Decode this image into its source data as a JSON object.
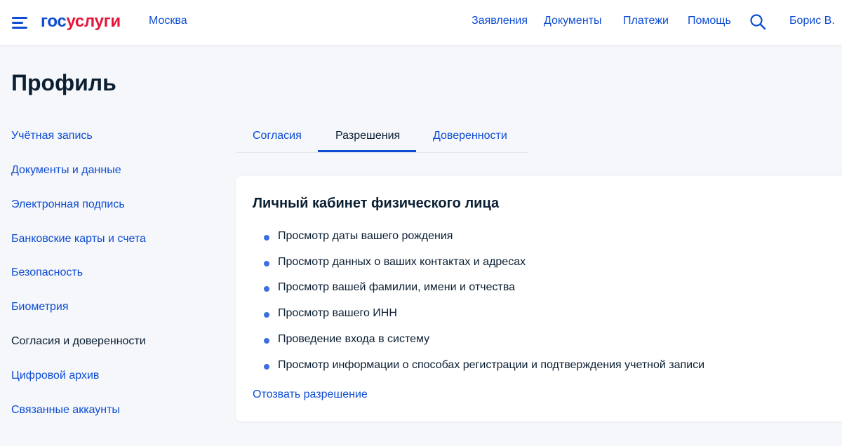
{
  "header": {
    "logo_part1": "гос",
    "logo_part2": "услуги",
    "city": "Москва",
    "nav": [
      "Заявления",
      "Документы",
      "Платежи",
      "Помощь"
    ],
    "user": "Борис В.",
    "icons": {
      "menu": "burger-menu-icon",
      "search": "search-icon"
    }
  },
  "page": {
    "title": "Профиль"
  },
  "sidebar": {
    "items": [
      {
        "label": "Учётная запись",
        "active": false
      },
      {
        "label": "Документы и данные",
        "active": false
      },
      {
        "label": "Электронная подпись",
        "active": false
      },
      {
        "label": "Банковские карты и счета",
        "active": false
      },
      {
        "label": "Безопасность",
        "active": false
      },
      {
        "label": "Биометрия",
        "active": false
      },
      {
        "label": "Согласия и доверенности",
        "active": true
      },
      {
        "label": "Цифровой архив",
        "active": false
      },
      {
        "label": "Связанные аккаунты",
        "active": false
      }
    ]
  },
  "tabs": {
    "items": [
      "Согласия",
      "Разрешения",
      "Доверенности"
    ],
    "active": "Разрешения"
  },
  "card": {
    "title": "Личный кабинет физического лица",
    "permissions": [
      "Просмотр даты вашего рождения",
      "Просмотр данных о ваших контактах и адресах",
      "Просмотр вашей фамилии, имени и отчества",
      "Просмотр вашего ИНН",
      "Проведение входа в систему",
      "Просмотр информации о способах регистрации и подтверждения учетной записи"
    ],
    "revoke_label": "Отозвать разрешение"
  },
  "colors": {
    "accent": "#0d4cd3",
    "logo_red": "#e4163a",
    "text": "#0b1f33",
    "background": "#f5f7fb",
    "bullet": "#3c6fe0"
  }
}
